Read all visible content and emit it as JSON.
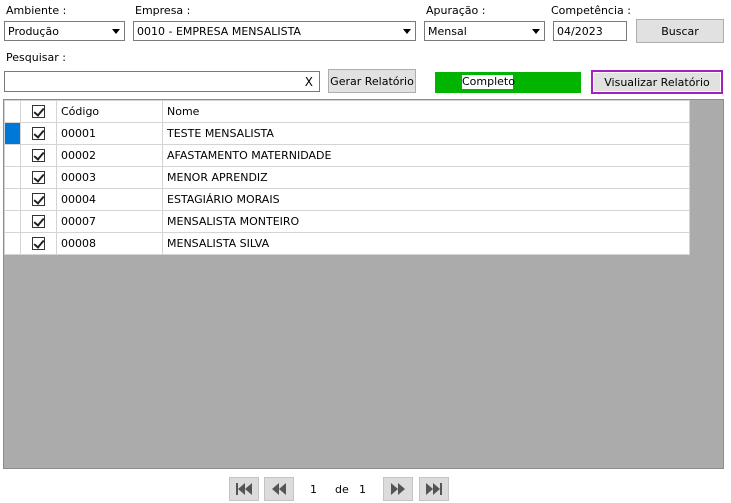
{
  "filters": {
    "ambiente": {
      "label": "Ambiente :",
      "value": "Produção"
    },
    "empresa": {
      "label": "Empresa :",
      "value": "0010 - EMPRESA MENSALISTA"
    },
    "apuracao": {
      "label": "Apuração :",
      "value": "Mensal"
    },
    "competencia": {
      "label": "Competência :",
      "value": "04/2023"
    },
    "buscar_label": "Buscar"
  },
  "search": {
    "label": "Pesquisar :",
    "value": "",
    "clear_label": "X"
  },
  "actions": {
    "gerar_label": "Gerar Relatório",
    "status_text": "Completo",
    "status_color": "#00b400",
    "visualizar_label": "Visualizar Relatório",
    "visualizar_border": "#a020c0"
  },
  "grid": {
    "columns": [
      "Código",
      "Nome"
    ],
    "rows": [
      {
        "codigo": "00001",
        "nome": "TESTE MENSALISTA",
        "checked": true
      },
      {
        "codigo": "00002",
        "nome": "AFASTAMENTO MATERNIDADE",
        "checked": true
      },
      {
        "codigo": "00003",
        "nome": "MENOR APRENDIZ",
        "checked": true
      },
      {
        "codigo": "00004",
        "nome": "ESTAGIÁRIO MORAIS",
        "checked": true
      },
      {
        "codigo": "00007",
        "nome": "MENSALISTA MONTEIRO",
        "checked": true
      },
      {
        "codigo": "00008",
        "nome": "MENSALISTA SILVA",
        "checked": true
      }
    ]
  },
  "pager": {
    "current": "1",
    "of_label": "de",
    "total": "1"
  },
  "icons": {
    "first": "first-page-icon",
    "prev": "previous-page-icon",
    "next": "next-page-icon",
    "last": "last-page-icon"
  }
}
